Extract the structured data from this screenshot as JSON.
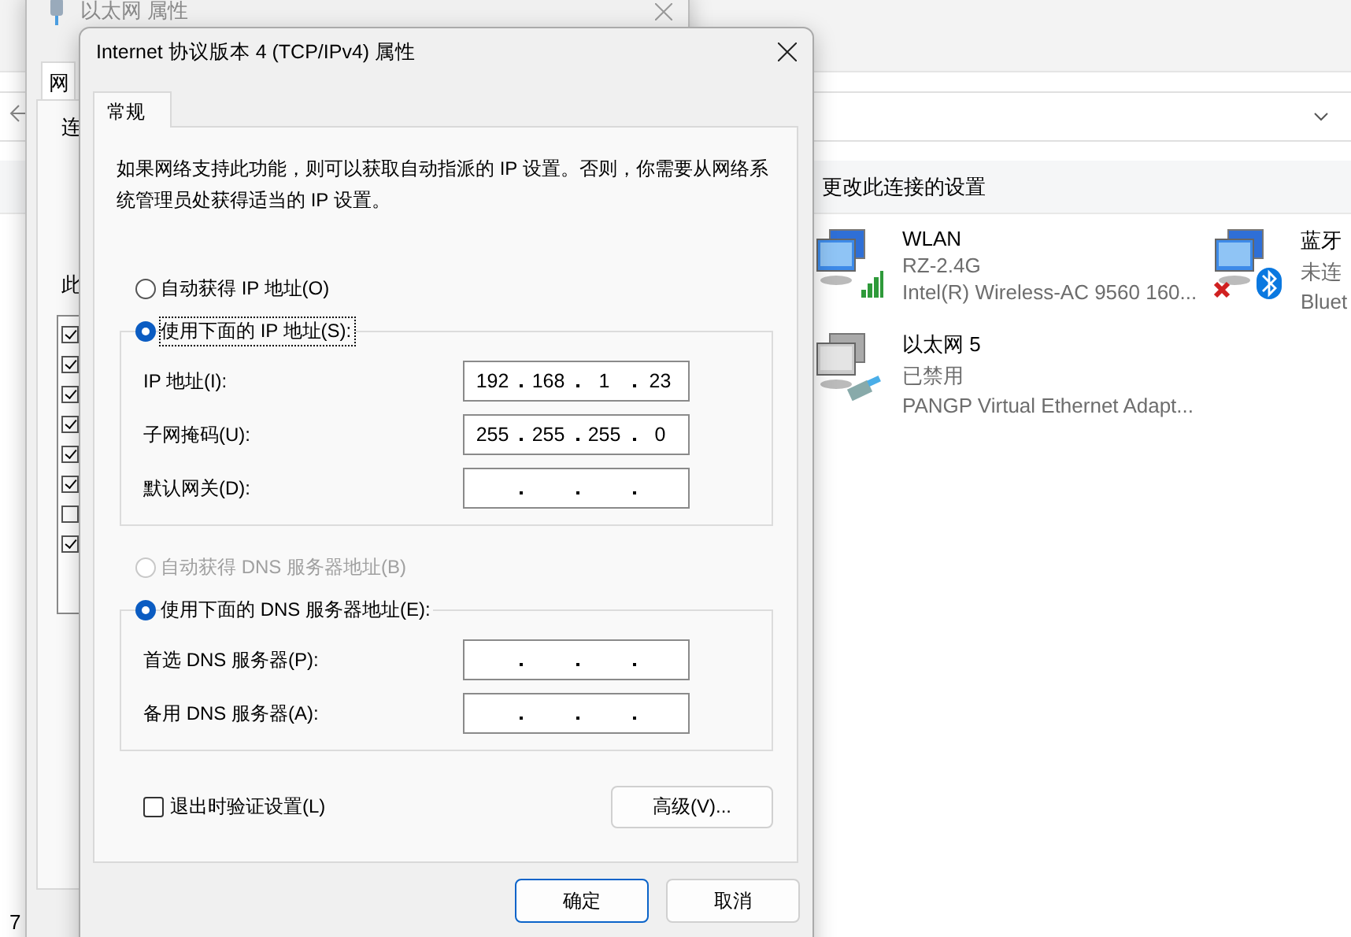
{
  "explorer": {
    "section_header": "更改此连接的设置",
    "status_text": "7",
    "connections": [
      {
        "kind": "wifi",
        "name": "WLAN",
        "status": "RZ-2.4G",
        "device": "Intel(R) Wireless-AC 9560 160..."
      },
      {
        "kind": "bluetooth",
        "name": "蓝牙",
        "status": "未连",
        "device": "Bluet"
      },
      {
        "kind": "ethernet",
        "name": "以太网 5",
        "status": "已禁用",
        "device": "PANGP Virtual Ethernet Adapt..."
      }
    ]
  },
  "ethernet_dialog": {
    "title": "以太网 属性",
    "tab": "网",
    "labels": [
      "连",
      "此"
    ],
    "components": [
      {
        "checked": true
      },
      {
        "checked": true
      },
      {
        "checked": true
      },
      {
        "checked": true
      },
      {
        "checked": true
      },
      {
        "checked": true
      },
      {
        "checked": false
      },
      {
        "checked": true
      }
    ]
  },
  "ipv4_dialog": {
    "title": "Internet 协议版本 4 (TCP/IPv4) 属性",
    "tab": "常规",
    "description": "如果网络支持此功能，则可以获取自动指派的 IP 设置。否则，你需要从网络系统管理员处获得适当的 IP 设置。",
    "sections": [
      {
        "options": [
          {
            "label": "自动获得 IP 地址(O)",
            "selected": false,
            "disabled": false,
            "focused": false
          },
          {
            "label": "使用下面的 IP 地址(S):",
            "selected": true,
            "disabled": false,
            "focused": true
          }
        ],
        "fields": [
          {
            "label": "IP 地址(I):",
            "octets": [
              "192",
              "168",
              "1",
              "23"
            ]
          },
          {
            "label": "子网掩码(U):",
            "octets": [
              "255",
              "255",
              "255",
              "0"
            ]
          },
          {
            "label": "默认网关(D):"
          }
        ]
      },
      {
        "options": [
          {
            "label": "自动获得 DNS 服务器地址(B)",
            "selected": false,
            "disabled": true,
            "focused": false
          },
          {
            "label": "使用下面的 DNS 服务器地址(E):",
            "selected": true,
            "disabled": false,
            "focused": false
          }
        ],
        "fields": [
          {
            "label": "首选 DNS 服务器(P):"
          },
          {
            "label": "备用 DNS 服务器(A):"
          }
        ]
      }
    ],
    "validate": {
      "label": "退出时验证设置(L)",
      "checked": false
    },
    "advanced_button": "高级(V)...",
    "buttons": [
      {
        "label": "确定",
        "default": true
      },
      {
        "label": "取消",
        "default": false
      }
    ]
  }
}
